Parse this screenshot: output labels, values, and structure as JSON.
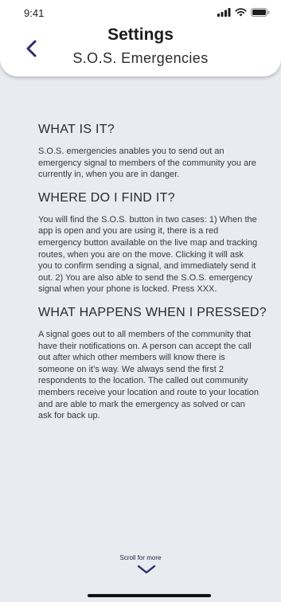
{
  "status": {
    "time": "9:41"
  },
  "header": {
    "title": "Settings",
    "subtitle": "S.O.S. Emergencies"
  },
  "sections": [
    {
      "heading": "WHAT IS IT?",
      "body": "S.O.S. emergencies anables you to send out an emergency signal to members of the community you are currently in, when you are in danger."
    },
    {
      "heading": "WHERE DO I FIND IT?",
      "body": "You will find the S.O.S. button in two cases: 1) When the app is open and you are using it, there is a red emergency button available on the live map and tracking routes, when you are on the move. Clicking it will ask you to confirm sending a signal, and immediately send it out. 2) You are also able to send the S.O.S. emergency signal when your phone is locked. Press XXX."
    },
    {
      "heading": "WHAT HAPPENS WHEN I PRESSED?",
      "body": "A signal goes out to all members of the community that have their notifications on. A person can accept the call out after which other members will know there is someone on it’s way. We always send the first 2 respondents to the location. The called out community members receive your location and route to your location and are able to mark the emergency as solved or can ask for back up."
    }
  ],
  "footer": {
    "scroll_label": "Scroll for more"
  },
  "icons": {
    "back": "chevron-left-icon",
    "scroll": "chevron-down-icon",
    "signal": "cellular-signal-icon",
    "wifi": "wifi-icon",
    "battery": "battery-icon"
  },
  "colors": {
    "accent": "#2d2b6b",
    "background": "#e8ebef"
  }
}
